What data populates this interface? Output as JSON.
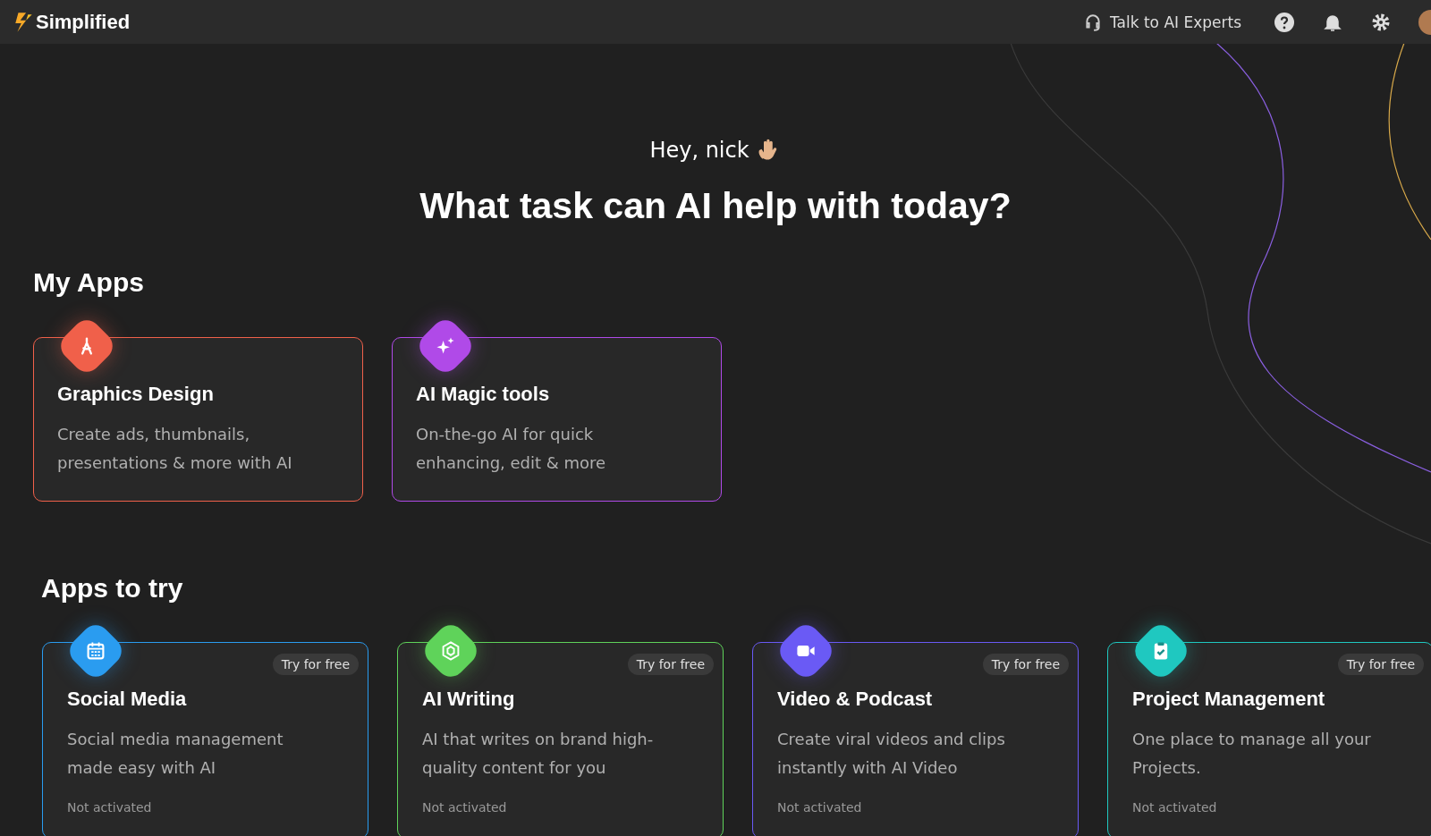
{
  "header": {
    "logo": "Simplified",
    "support_link": "Talk to AI Experts"
  },
  "greeting": "Hey, nick",
  "headline": "What task can AI help with today?",
  "my_apps": {
    "title": "My Apps",
    "cards": [
      {
        "kind": "compass",
        "color": "#f0604a",
        "title": "Graphics Design",
        "description": "Create ads, thumbnails, presentations & more with AI"
      },
      {
        "kind": "sparkle",
        "color": "#b04ae8",
        "title": "AI Magic tools",
        "description": "On-the-go AI for quick enhancing, edit & more"
      }
    ]
  },
  "apps_to_try": {
    "title": "Apps to try",
    "cards": [
      {
        "kind": "calendar",
        "color": "#2a9cf0",
        "badge": "Try for free",
        "title": "Social Media",
        "description": "Social media management made easy with AI",
        "status": "Not activated"
      },
      {
        "kind": "cube",
        "color": "#5fd35a",
        "badge": "Try for free",
        "title": "AI Writing",
        "description": "AI that writes on brand high-quality content for you",
        "status": "Not activated"
      },
      {
        "kind": "video",
        "color": "#6a5af5",
        "badge": "Try for free",
        "title": "Video & Podcast",
        "description": "Create viral videos and clips instantly with AI Video",
        "status": "Not activated"
      },
      {
        "kind": "clipboard",
        "color": "#1fc8c0",
        "badge": "Try for free",
        "title": "Project Management",
        "description": "One place to manage all your Projects.",
        "status": "Not activated"
      }
    ]
  }
}
